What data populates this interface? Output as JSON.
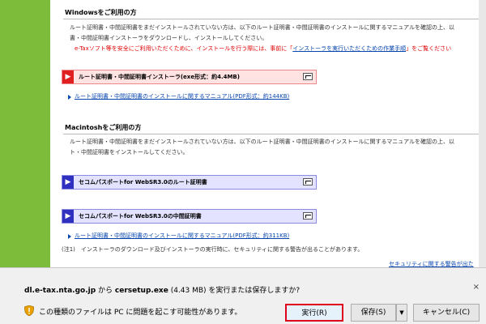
{
  "windows_section": {
    "title": "Windowsをご利用の方",
    "para_line1": "ルート証明書・中間証明書をまだインストールされていない方は、以下のルート証明書・中間証明書のインストールに関するマニュアルを確認の上、以",
    "para_line2": "書・中間証明書インストーラをダウンロードし、インストールしてください。",
    "warning_prefix": "e-Taxソフト等を安全にご利用いただくために、インストールを行う際には、事前に「",
    "warning_link": "インストーラを実行いただくための作業手順",
    "warning_suffix": "」をご覧ください",
    "download_button": "ルート証明書・中間証明書インストーラ(exe形式：約4.4MB)",
    "manual_link": "ルート証明書・中間証明書のインストールに関するマニュアル(PDF形式：約144KB)"
  },
  "mac_section": {
    "title": "Macintoshをご利用の方",
    "para_line1": "ルート証明書・中間証明書をまだインストールされていない方は、以下のルート証明書・中間証明書のインストールに関するマニュアルを確認の上、以",
    "para_line2": "ト・中間証明書をインストールしてください。",
    "root_button": "セコムパスポートfor WebSR3.0のルート証明書",
    "intermediate_button": "セコムパスポートfor WebSR3.0の中間証明書",
    "manual_link": "ルート証明書・中間証明書のインストールに関するマニュアル(PDF形式：約311KB)"
  },
  "note": "(注1)　インストーラのダウンロード及びインストーラの実行時に、セキュリティに関する警告が出ることがあります。",
  "security_link": "セキュリティに関する警告が出た",
  "download_bar": {
    "host": "dl.e-tax.nta.go.jp",
    "from_text": " から ",
    "filename": "cersetup.exe",
    "size_text": " (4.43 MB) を実行または保存しますか?",
    "warning": "この種類のファイルは PC に問題を起こす可能性があります。",
    "run_label": "実行(R)",
    "save_label": "保存(S)",
    "save_dropdown": "▼",
    "cancel_label": "キャンセル(C)",
    "close_glyph": "×"
  },
  "icons": {
    "close": "close-icon",
    "shield": "shield-warning-icon",
    "dropdown": "chevron-down-icon",
    "arrow": "arrow-right-icon",
    "window": "window-icon"
  },
  "colors": {
    "accent_red": "#e02020",
    "accent_blue": "#3030c0",
    "sidebar_green": "#7dbb3b",
    "link_blue": "#0645ad",
    "highlight_border": "#e0001b"
  }
}
